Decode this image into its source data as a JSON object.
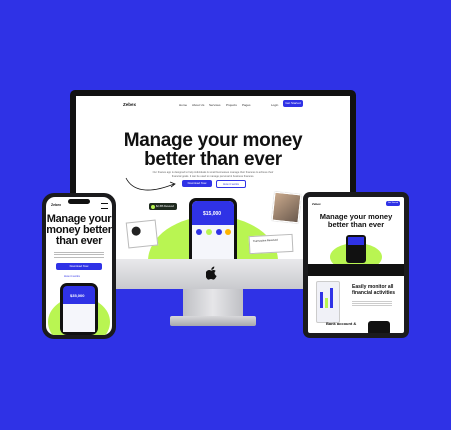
{
  "brand": {
    "name": "Zebex",
    "accent": "#2f32e6",
    "highlight": "#b9f552",
    "background": "#2f32e6"
  },
  "nav": {
    "links": [
      "Home",
      "About Us",
      "Services",
      "Projects",
      "Pages"
    ],
    "login": "Login",
    "signup": "Get Started"
  },
  "hero": {
    "title_line1": "Manage your money",
    "title_line2": "better than ever",
    "subtitle": "Our finance app is designed to help individuals & small businesses manage their finances & achieve their financial goals. It can be used to manage personal & business finances.",
    "cta_primary": "Download Now",
    "cta_secondary": "How it works",
    "balance": "$15,000",
    "badge_label": "$2,456 Received",
    "tooltip_label": "Transaction Received"
  },
  "mobile": {
    "title_line1": "Manage your",
    "title_line2": "money better",
    "title_line3": "than ever",
    "cta_primary": "Download Now",
    "cta_secondary": "How it works",
    "balance": "$35,000"
  },
  "tablet": {
    "title_line1": "Manage your money",
    "title_line2": "better than ever",
    "feature_title_line1": "Easily monitor all",
    "feature_title_line2": "financial activities",
    "section2_title": "Bank account &"
  }
}
